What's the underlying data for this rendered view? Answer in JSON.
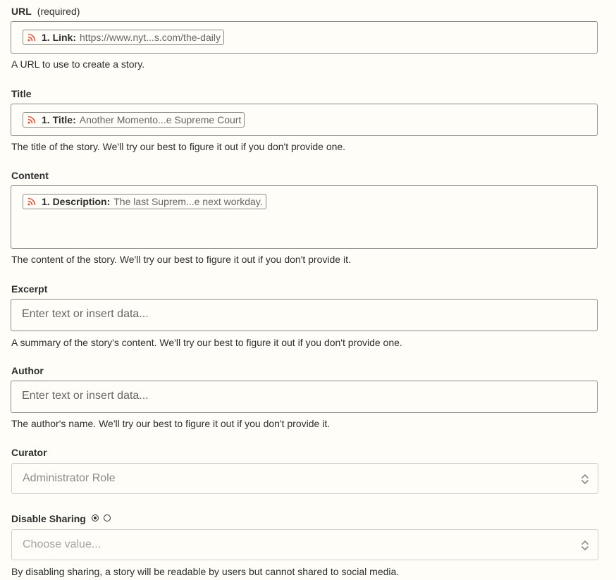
{
  "url": {
    "label": "URL",
    "required_note": "(required)",
    "pill_key": "1. Link:",
    "pill_value": "https://www.nyt...s.com/the-daily",
    "help": "A URL to use to create a story."
  },
  "title": {
    "label": "Title",
    "pill_key": "1. Title:",
    "pill_value": "Another Momento...e Supreme Court",
    "help": "The title of the story. We'll try our best to figure it out if you don't provide one."
  },
  "content": {
    "label": "Content",
    "pill_key": "1. Description:",
    "pill_value": "The last Suprem...e next workday.",
    "help": "The content of the story. We'll try our best to figure it out if you don't provide it."
  },
  "excerpt": {
    "label": "Excerpt",
    "placeholder": "Enter text or insert data...",
    "help": "A summary of the story's content. We'll try our best to figure it out if you don't provide one."
  },
  "author": {
    "label": "Author",
    "placeholder": "Enter text or insert data...",
    "help": "The author's name. We'll try our best to figure it out if you don't provide it."
  },
  "curator": {
    "label": "Curator",
    "value": "Administrator Role"
  },
  "disable_sharing": {
    "label": "Disable Sharing",
    "placeholder": "Choose value...",
    "help": "By disabling sharing, a story will be readable by users but cannot shared to social media."
  },
  "colors": {
    "background": "#fffdf8",
    "rss_accent": "#e8533a",
    "border": "#8b8b8b"
  },
  "icons": {
    "pill": "rss-icon",
    "select": "chevron-up-down-icon"
  }
}
